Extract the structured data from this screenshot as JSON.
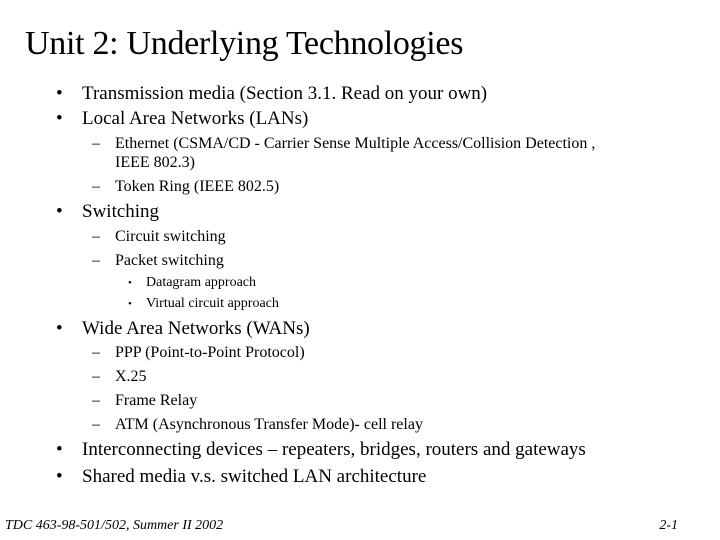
{
  "slide": {
    "title": "Unit 2: Underlying Technologies",
    "bullets": {
      "b1": "Transmission media (Section 3.1. Read on your own)",
      "b2": "Local Area Networks (LANs)",
      "b2_sub1_line1": "Ethernet (CSMA/CD - Carrier Sense Multiple Access/Collision Detection ,",
      "b2_sub1_line2": "IEEE 802.3)",
      "b2_sub2": "Token Ring (IEEE 802.5)",
      "b3": "Switching",
      "b3_sub1": "Circuit switching",
      "b3_sub2": "Packet switching",
      "b3_sub2_sub1": "Datagram approach",
      "b3_sub2_sub2": "Virtual circuit approach",
      "b4": "Wide Area Networks (WANs)",
      "b4_sub1": "PPP (Point-to-Point Protocol)",
      "b4_sub2": "X.25",
      "b4_sub3": "Frame Relay",
      "b4_sub4": "ATM (Asynchronous Transfer Mode)- cell relay",
      "b5": "Interconnecting devices – repeaters, bridges, routers and gateways",
      "b6": "Shared media v.s. switched LAN architecture"
    },
    "markers": {
      "level1": "•",
      "level2": "–",
      "level3": "•"
    }
  },
  "footer": {
    "course": "TDC 463-98-501/502, Summer II 2002",
    "page": "2-1"
  }
}
